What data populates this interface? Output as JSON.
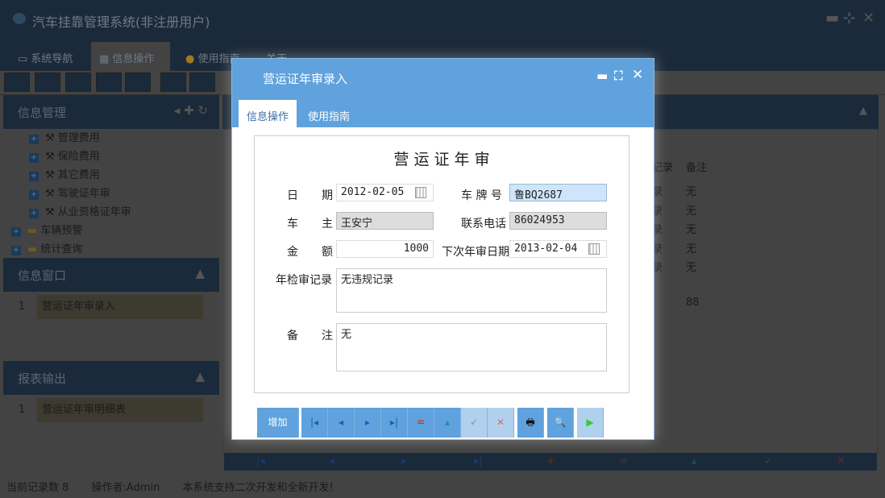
{
  "app": {
    "title": "汽车挂靠管理系统(非注册用户)"
  },
  "tabs": [
    {
      "label": "系统导航"
    },
    {
      "label": "信息操作"
    },
    {
      "label": "使用指南"
    },
    {
      "label": "关于"
    }
  ],
  "sidebar": {
    "info_mgmt": {
      "title": "信息管理",
      "items": [
        "管理费用",
        "保险费用",
        "其它费用",
        "驾驶证年审",
        "从业资格证年审"
      ],
      "folders": [
        "车辆预警",
        "统计查询"
      ]
    },
    "info_window": {
      "title": "信息窗口",
      "rows": [
        {
          "n": "1",
          "label": "营运证年审录入"
        }
      ]
    },
    "report": {
      "title": "报表输出",
      "rows": [
        {
          "n": "1",
          "label": "营运证年审明细表"
        }
      ]
    }
  },
  "grid": {
    "headers": [
      "记录",
      "备注"
    ],
    "rows": [
      [
        "录",
        "无"
      ],
      [
        "录",
        "无"
      ],
      [
        "录",
        "无"
      ],
      [
        "录",
        "无"
      ],
      [
        "录",
        "无"
      ],
      [
        "",
        ""
      ],
      [
        "",
        "88"
      ]
    ]
  },
  "status": {
    "records": "当前记录数 8",
    "operator": "操作者:Admin",
    "note": "本系统支持二次开发和全新开发!"
  },
  "modal": {
    "title": "营运证年审录入",
    "tabs": [
      "信息操作",
      "使用指南"
    ],
    "form_title": "营 运 证 年 审",
    "fields": {
      "date": {
        "label1": "日",
        "label2": "期",
        "value": "2012-02-05"
      },
      "plate": {
        "label": "车 牌 号",
        "value": "鲁BQ2687"
      },
      "owner": {
        "label1": "车",
        "label2": "主",
        "value": "王安宁"
      },
      "phone": {
        "label": "联系电话",
        "value": "86024953"
      },
      "amount": {
        "label1": "金",
        "label2": "额",
        "value": "1000"
      },
      "next_date": {
        "label": "下次年审日期",
        "value": "2013-02-04"
      },
      "record": {
        "label": "年检审记录",
        "value": "无违规记录"
      },
      "remark": {
        "label1": "备",
        "label2": "注",
        "value": "无"
      }
    },
    "buttons": {
      "add": "增加"
    }
  }
}
